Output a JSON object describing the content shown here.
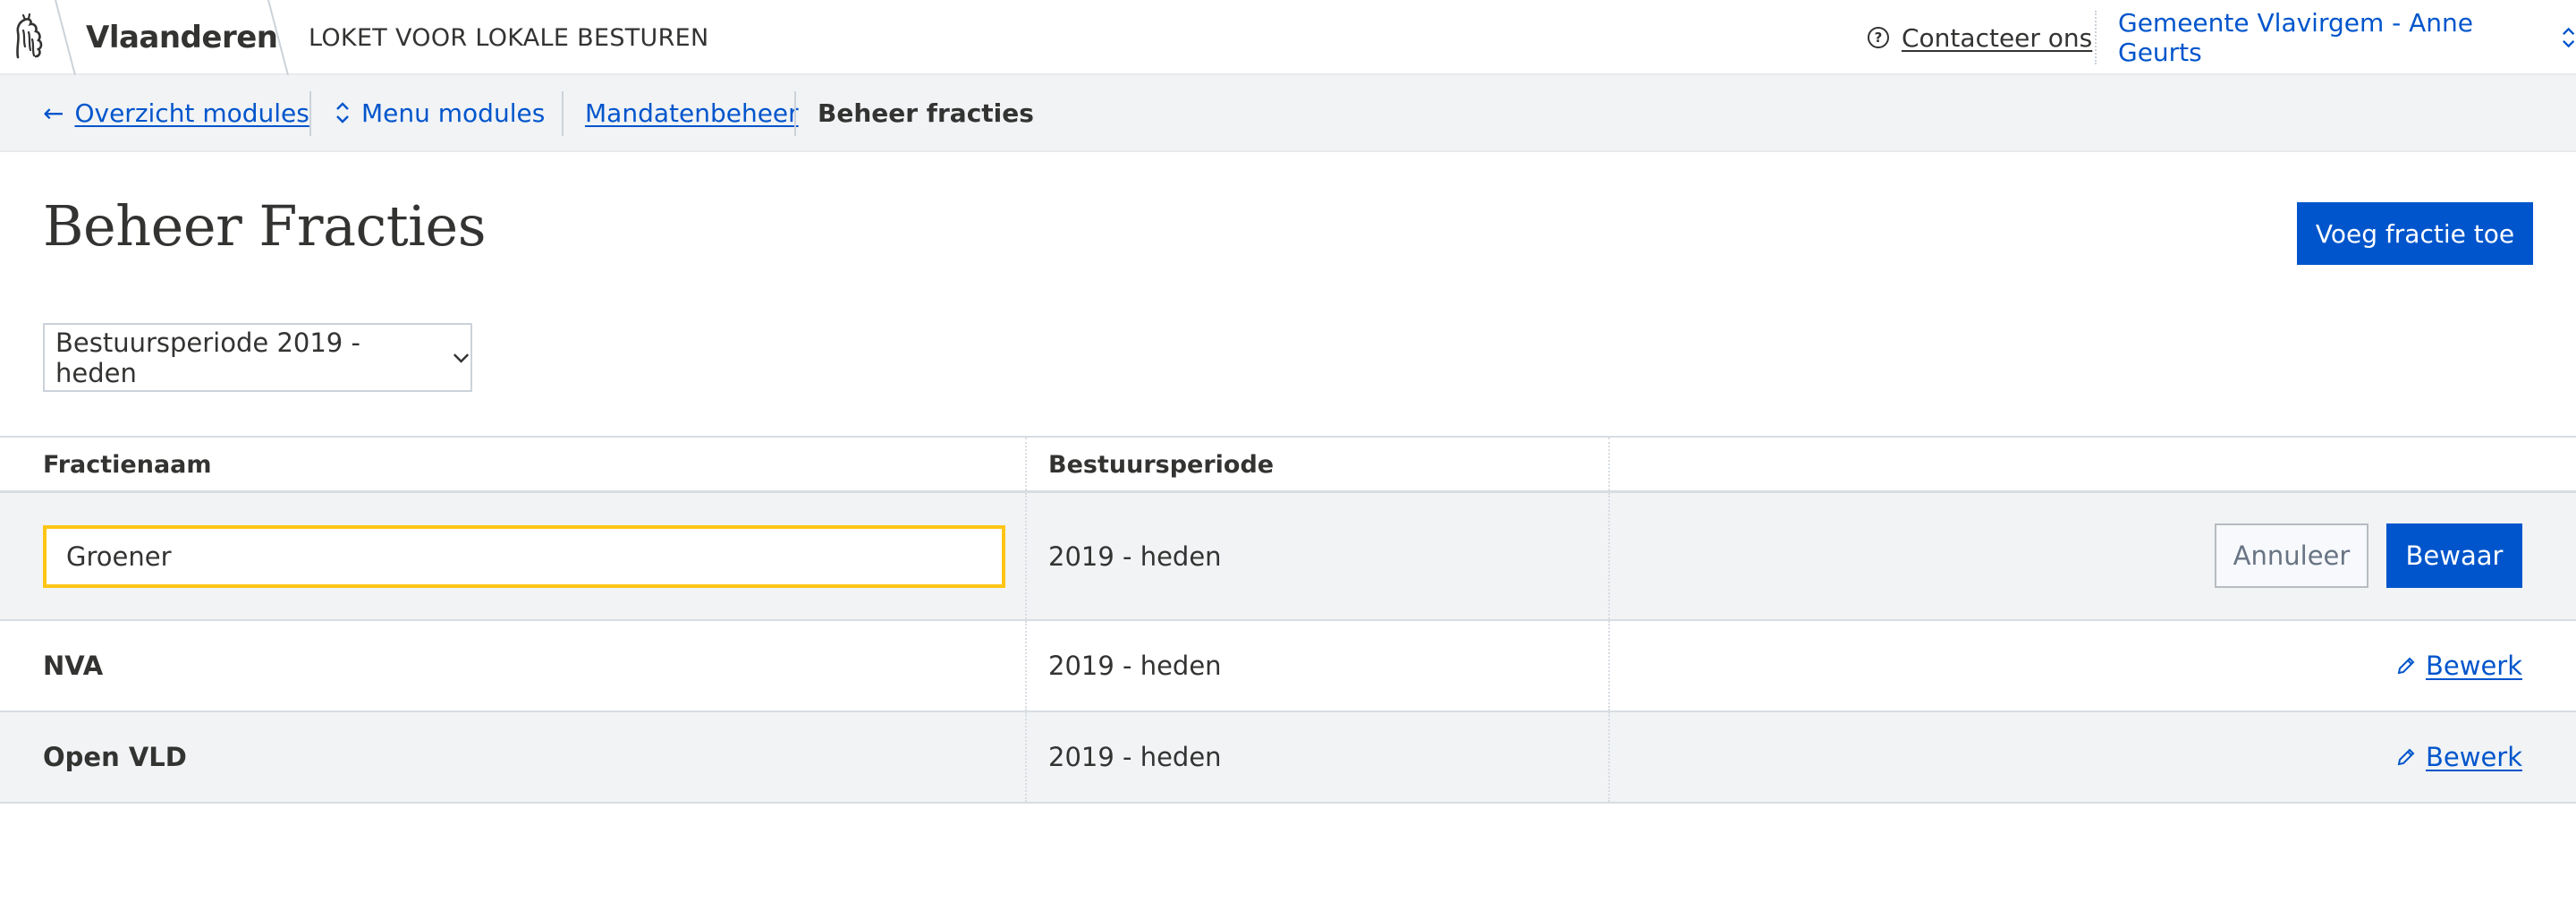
{
  "header": {
    "brand": "Vlaanderen",
    "app_name": "LOKET VOOR LOKALE BESTUREN",
    "contact_label": "Contacteer ons",
    "account_label": "Gemeente Vlavirgem - Anne Geurts",
    "logo_icon": "flemish-lion-icon",
    "contact_icon": "question-circle-icon",
    "account_icon": "chevron-updown-icon"
  },
  "subnav": {
    "back_arrow": "←",
    "back_label": "Overzicht modules",
    "menu_label": "Menu modules",
    "menu_icon": "chevron-updown-icon",
    "breadcrumb_parent": "Mandatenbeheer",
    "breadcrumb_current": "Beheer fracties"
  },
  "page": {
    "title": "Beheer Fracties",
    "add_button": "Voeg fractie toe",
    "period_select": {
      "selected": "Bestuursperiode 2019 - heden",
      "icon": "chevron-down-icon"
    }
  },
  "table": {
    "columns": [
      "Fractienaam",
      "Bestuursperiode",
      ""
    ],
    "editing_row": {
      "name_value": "Groener",
      "period": "2019 - heden",
      "cancel_label": "Annuleer",
      "save_label": "Bewaar"
    },
    "rows": [
      {
        "name": "NVA",
        "period": "2019 - heden",
        "action": "Bewerk",
        "action_icon": "pencil-icon"
      },
      {
        "name": "Open VLD",
        "period": "2019 - heden",
        "action": "Bewerk",
        "action_icon": "pencil-icon"
      }
    ]
  },
  "colors": {
    "accent": "#0055cc",
    "focus": "#ffc515",
    "text": "#333332",
    "alt_background": "#f1f3f5"
  }
}
